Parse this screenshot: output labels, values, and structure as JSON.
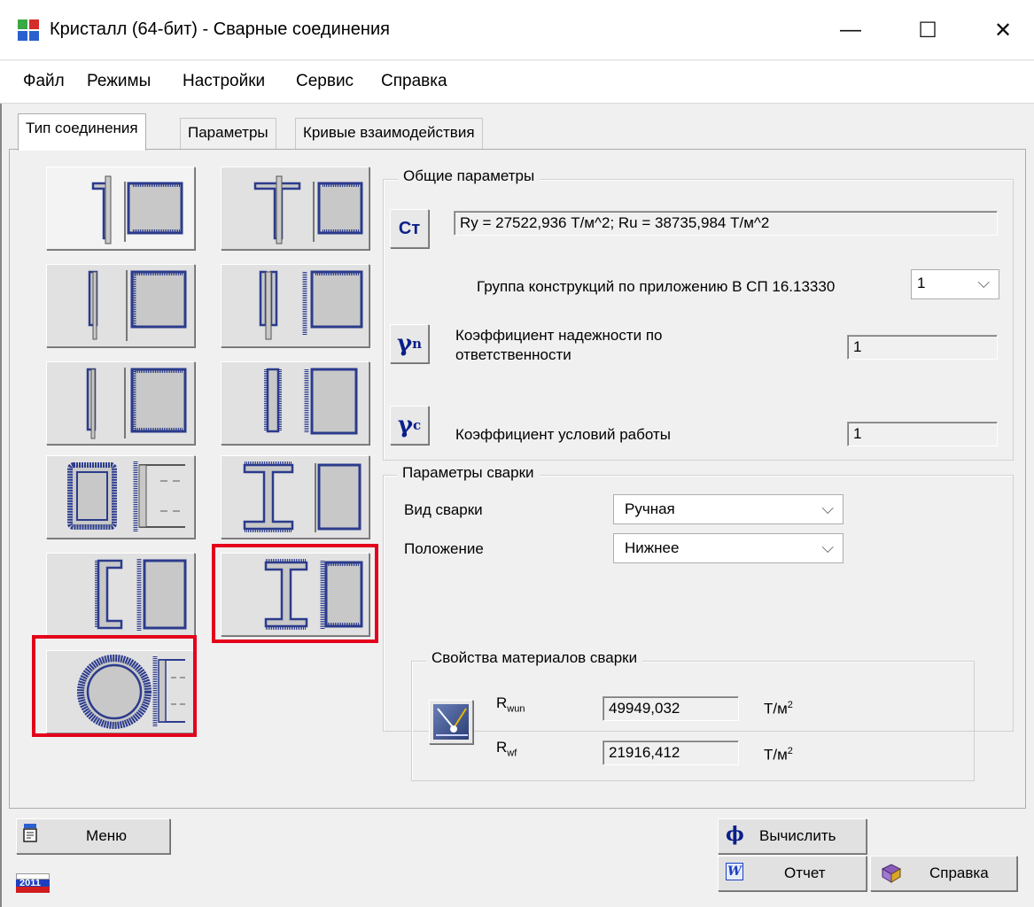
{
  "window": {
    "title": "Кристалл (64-бит) - Сварные соединения",
    "minimize": "—",
    "maximize": "☐",
    "close": "✕"
  },
  "menu": [
    "Файл",
    "Режимы",
    "Настройки",
    "Сервис",
    "Справка"
  ],
  "tabs": [
    "Тип соединения",
    "Параметры",
    "Кривые взаимодействия"
  ],
  "joint_types": [
    "angle-to-plate",
    "tee-to-plate",
    "flat-single-side",
    "flat-double-side",
    "flat-single-welded",
    "two-flats-side",
    "rectangular-tube",
    "i-beam-flange-weld",
    "channel",
    "i-beam-full-weld",
    "round-tube"
  ],
  "general": {
    "title": "Общие параметры",
    "steel_button": "Ст",
    "steel_value": "Ry = 27522,936 Т/м^2; Ru = 38735,984 Т/м^2",
    "group_label": "Группа конструкций по приложению В СП 16.13330",
    "group_value": "1",
    "gamma_n_label": "Коэффициент надежности по ответственности",
    "gamma_n_value": "1",
    "gamma_c_label": "Коэффициент условий работы",
    "gamma_c_value": "1",
    "gamma_n_symbol": "γ",
    "gamma_n_sub": "n",
    "gamma_c_symbol": "γ",
    "gamma_c_sub": "c"
  },
  "weld": {
    "title": "Параметры сварки",
    "type_label": "Вид сварки",
    "type_value": "Ручная",
    "position_label": "Положение",
    "position_value": "Нижнее"
  },
  "material": {
    "title": "Свойства материалов сварки",
    "rwun_label": "R",
    "rwun_sub": "wun",
    "rwun_value": "49949,032",
    "rwf_label": "R",
    "rwf_sub": "wf",
    "rwf_value": "21916,412",
    "unit": "Т/м",
    "unit_sup": "2"
  },
  "bottom": {
    "menu": "Меню",
    "calculate": "Вычислить",
    "report": "Отчет",
    "help": "Справка",
    "year": "2011",
    "phi": "ϕ",
    "word": "W"
  },
  "colors": {
    "accent_blue": "#0a1f8a",
    "highlight_red": "#e4001b",
    "steel_gray": "#c8c8c8",
    "weld_blue": "#2b3b8c"
  }
}
